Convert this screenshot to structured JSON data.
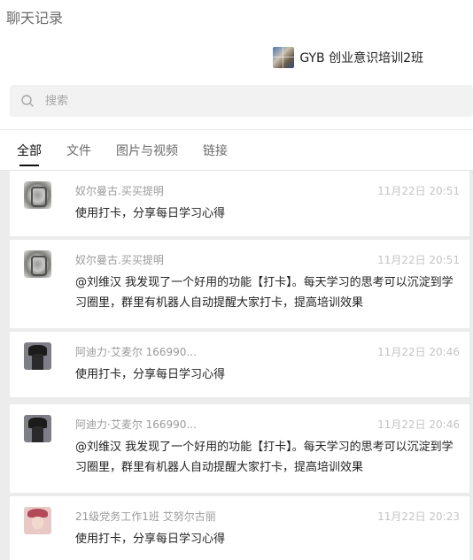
{
  "window": {
    "title": "聊天记录"
  },
  "chat": {
    "name": "GYB 创业意识培训2班"
  },
  "search": {
    "placeholder": "搜索",
    "value": ""
  },
  "tabs": [
    {
      "label": "全部",
      "active": true
    },
    {
      "label": "文件",
      "active": false
    },
    {
      "label": "图片与视频",
      "active": false
    },
    {
      "label": "链接",
      "active": false
    }
  ],
  "messages": [
    {
      "sender": "奴尔曼古.买买提明",
      "time": "11月22日 20:51",
      "text": "使用打卡，分享每日学习心得"
    },
    {
      "sender": "奴尔曼古.买买提明",
      "time": "11月22日 20:51",
      "text": "@刘维汉  我发现了一个好用的功能【打卡】。每天学习的思考可以沉淀到学习圈里，群里有机器人自动提醒大家打卡，提高培训效果"
    },
    {
      "sender": "阿迪力·艾麦尔 166990...",
      "time": "11月22日 20:46",
      "text": "使用打卡，分享每日学习心得"
    },
    {
      "sender": "阿迪力·艾麦尔 166990...",
      "time": "11月22日 20:46",
      "text": "@刘维汉  我发现了一个好用的功能【打卡】。每天学习的思考可以沉淀到学习圈里，群里有机器人自动提醒大家打卡，提高培训效果"
    },
    {
      "sender": "21级党务工作1班 艾努尔古丽",
      "time": "11月22日 20:23",
      "text": "使用打卡，分享每日学习心得"
    }
  ],
  "icons": {
    "search": "search-icon"
  }
}
